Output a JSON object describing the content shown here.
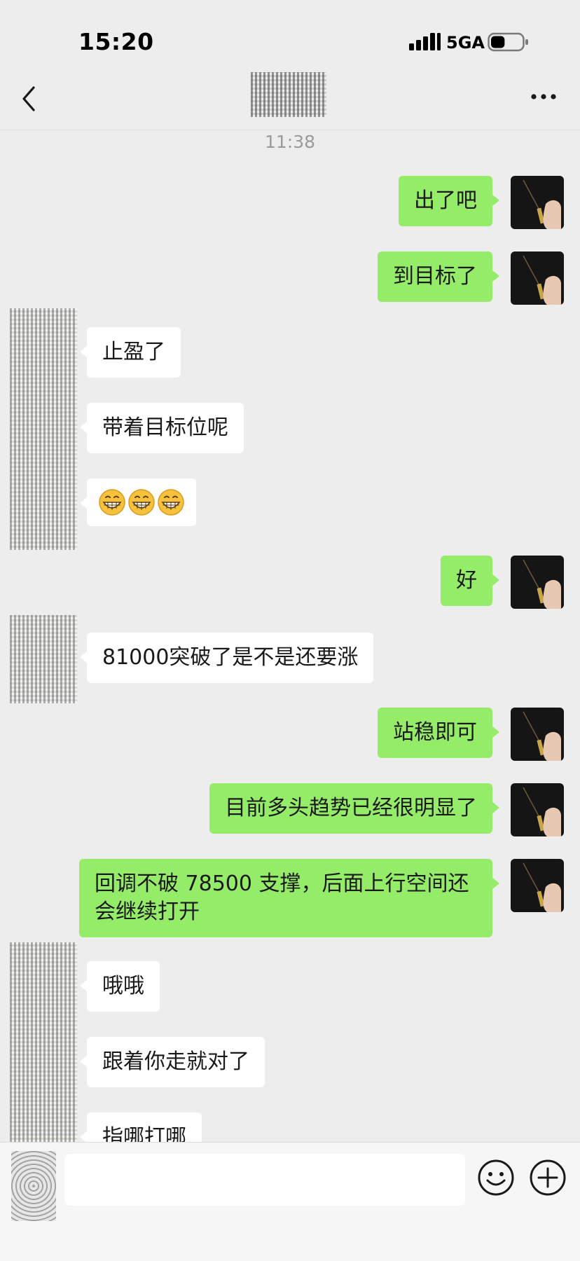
{
  "status_bar": {
    "time": "15:20",
    "network": "5GA",
    "battery_level": 0.45
  },
  "nav": {
    "back_icon": "chevron-left-icon",
    "more_icon": "more-dots-icon"
  },
  "chat": {
    "timestamp": "11:38",
    "messages": [
      {
        "sender": "me",
        "text": "出了吧"
      },
      {
        "sender": "me",
        "text": "到目标了"
      },
      {
        "sender": "friend",
        "text": "止盈了"
      },
      {
        "sender": "friend",
        "text": "带着目标位呢"
      },
      {
        "sender": "friend",
        "emoji": [
          "grin-emoji",
          "grin-emoji",
          "grin-emoji"
        ]
      },
      {
        "sender": "me",
        "text": "好"
      },
      {
        "sender": "friend",
        "text": "81000突破了是不是还要涨"
      },
      {
        "sender": "me",
        "text": "站稳即可"
      },
      {
        "sender": "me",
        "text": "目前多头趋势已经很明显了"
      },
      {
        "sender": "me",
        "text": "回调不破 78500 支撑，后面上行空间还会继续打开"
      },
      {
        "sender": "friend",
        "text": "哦哦"
      },
      {
        "sender": "friend",
        "text": "跟着你走就对了"
      },
      {
        "sender": "friend",
        "text": "指哪打哪"
      }
    ]
  },
  "input_bar": {
    "value": "",
    "emoji_icon": "smiley-icon",
    "add_icon": "plus-circle-icon"
  },
  "colors": {
    "background": "#ededed",
    "my_bubble": "#95ec69",
    "friend_bubble": "#ffffff",
    "timestamp": "#9a9a9a"
  }
}
